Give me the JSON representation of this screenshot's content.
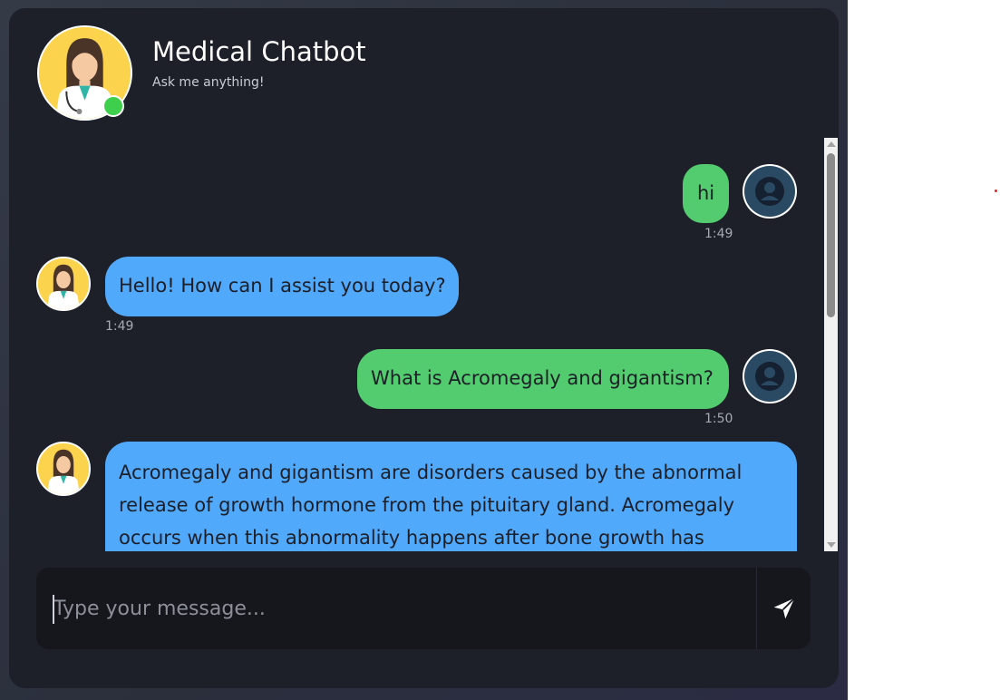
{
  "header": {
    "title": "Medical Chatbot",
    "subtitle": "Ask me anything!",
    "status": "online"
  },
  "messages": [
    {
      "sender": "user",
      "text": "hi",
      "time": "1:49"
    },
    {
      "sender": "bot",
      "text": "Hello! How can I assist you today?",
      "time": "1:49"
    },
    {
      "sender": "user",
      "text": "What is Acromegaly and gigantism?",
      "time": "1:50"
    },
    {
      "sender": "bot",
      "text": "Acromegaly and gigantism are disorders caused by the abnormal release of growth hormone from the pituitary gland. Acromegaly occurs when this abnormality happens after bone growth has"
    }
  ],
  "input": {
    "placeholder": "Type your message...",
    "value": ""
  },
  "icons": {
    "send": "send-icon",
    "user_avatar": "user-icon",
    "bot_avatar": "doctor-avatar"
  },
  "colors": {
    "user_bubble": "#52cc6e",
    "bot_bubble": "#51a9fc",
    "online": "#3ecf4c",
    "card": "#1d2029"
  }
}
